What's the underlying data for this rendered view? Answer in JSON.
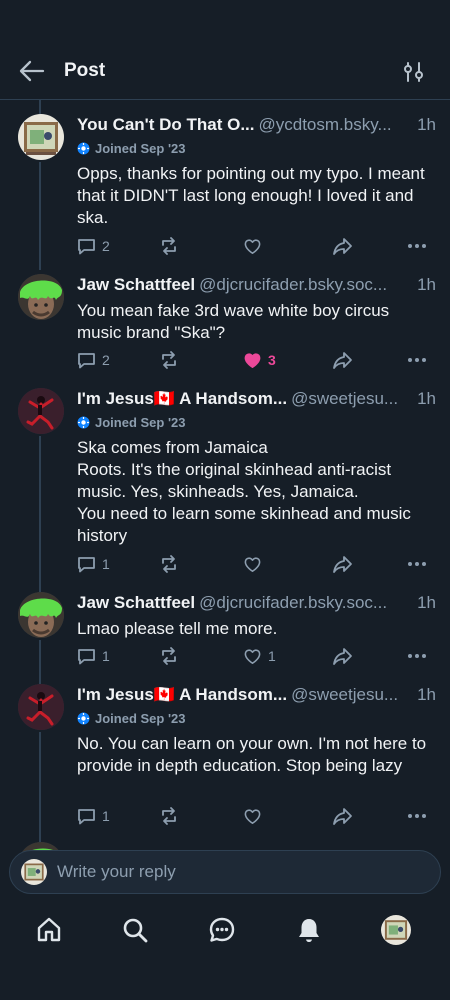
{
  "header": {
    "title": "Post"
  },
  "posts": [
    {
      "author": "You Can't Do That O...",
      "handle": "@ycdtosm.bsky...",
      "time": "1h",
      "joined": "Joined Sep '23",
      "text": "Opps, thanks for pointing out my typo. I meant that it DIDN'T last long enough! I loved it and ska.",
      "replies": "2",
      "likes": "",
      "liked": false
    },
    {
      "author": "Jaw Schattfeel",
      "handle": "@djcrucifader.bsky.soc...",
      "time": "1h",
      "joined": "",
      "text": "You mean fake 3rd wave white boy circus music brand \"Ska\"?",
      "replies": "2",
      "likes": "3",
      "liked": true
    },
    {
      "author": "I'm Jesus🇨🇦 A Handsom...",
      "handle": "@sweetjesu...",
      "time": "1h",
      "joined": "Joined Sep '23",
      "text": "Ska comes from Jamaica\nRoots. It's the original skinhead anti-racist music. Yes, skinheads. Yes, Jamaica.\nYou need to learn some skinhead and music history",
      "replies": "1",
      "likes": "",
      "liked": false
    },
    {
      "author": "Jaw Schattfeel",
      "handle": "@djcrucifader.bsky.soc...",
      "time": "1h",
      "joined": "",
      "text": "Lmao please tell me more.",
      "replies": "1",
      "likes": "1",
      "liked": false
    },
    {
      "author": "I'm Jesus🇨🇦 A Handsom...",
      "handle": "@sweetjesu...",
      "time": "1h",
      "joined": "Joined Sep '23",
      "text": "No. You can learn on your own. I'm not here to provide in depth education. Stop being lazy",
      "replies": "1",
      "likes": "",
      "liked": false
    }
  ],
  "reply_bar": {
    "placeholder": "Write your reply"
  },
  "colors": {
    "background": "#161e27",
    "text": "#f1f3f5",
    "muted": "#8d9eaf",
    "border": "#2e4052",
    "like": "#ec4899",
    "joined_badge": "#1083fe"
  },
  "icons": {
    "back": "arrow-left-icon",
    "filter": "sliders-icon",
    "reply": "speech-bubble-icon",
    "repost": "repost-icon",
    "like": "heart-icon",
    "share": "share-arrow-icon",
    "more": "ellipsis-icon",
    "nav": [
      "home-icon",
      "search-icon",
      "chat-icon",
      "bell-icon",
      "profile-avatar"
    ]
  }
}
